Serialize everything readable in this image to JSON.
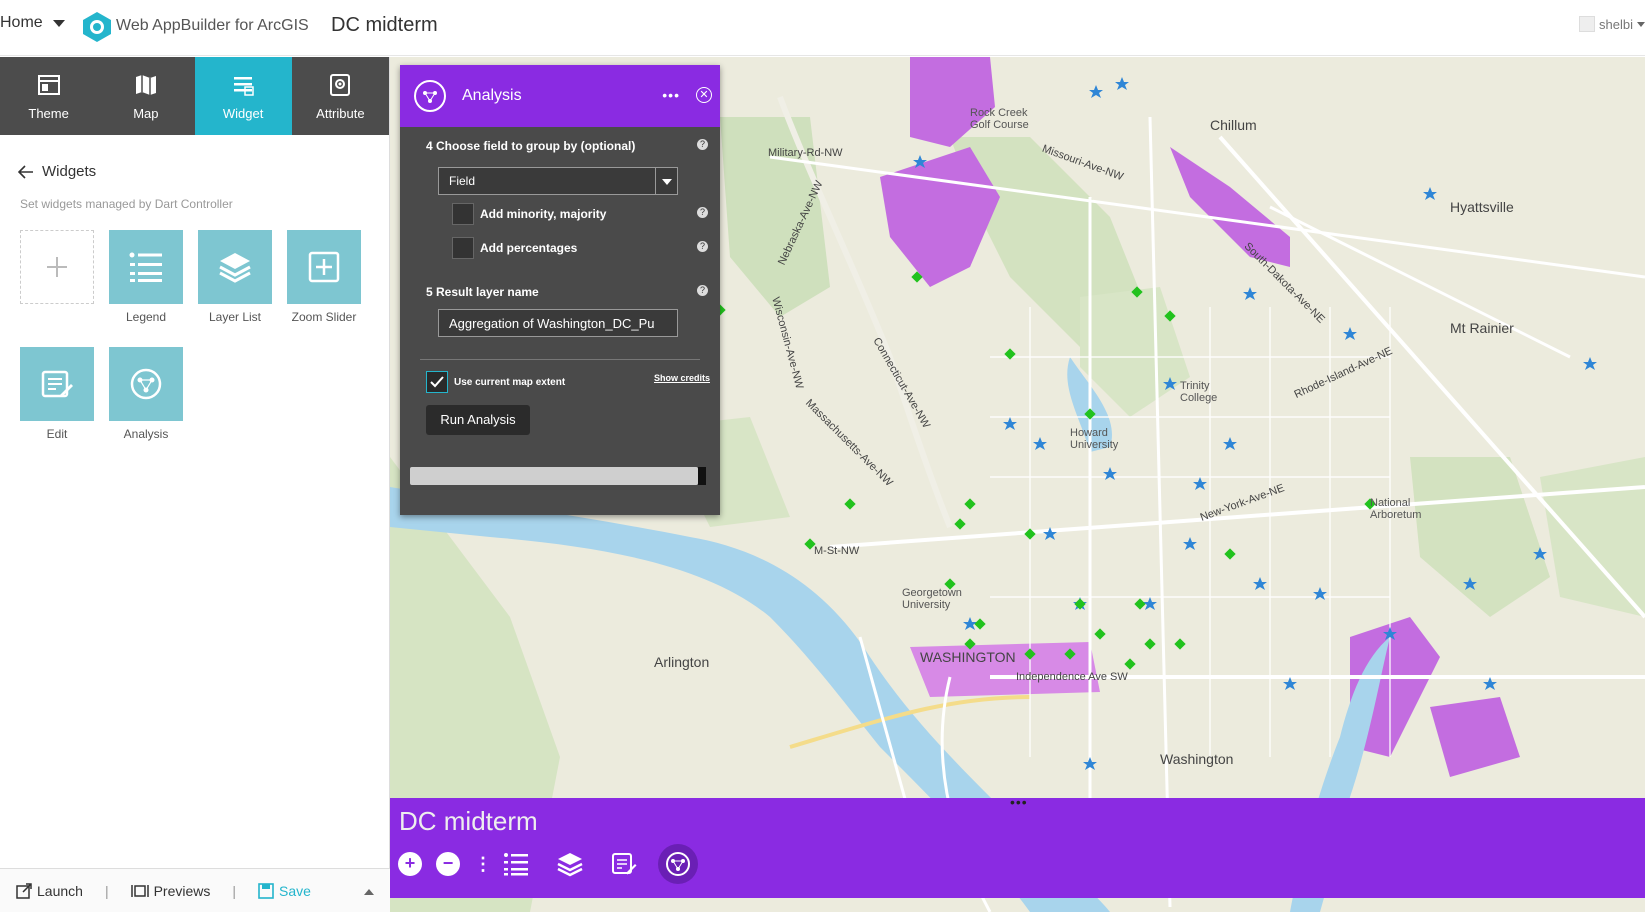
{
  "header": {
    "home_label": "Home",
    "brand_label": "Web AppBuilder for ArcGIS",
    "app_title": "DC midterm",
    "user_name": "shelbi"
  },
  "left_panel": {
    "tabs": [
      {
        "label": "Theme",
        "icon": "theme-icon"
      },
      {
        "label": "Map",
        "icon": "map-icon"
      },
      {
        "label": "Widget",
        "icon": "widget-icon"
      },
      {
        "label": "Attribute",
        "icon": "attribute-icon"
      }
    ],
    "active_tab": "Widget",
    "breadcrumb": "Widgets",
    "subtitle": "Set widgets managed by Dart Controller",
    "widgets": [
      {
        "label": "",
        "icon": "plus-icon"
      },
      {
        "label": "Legend",
        "icon": "legend-icon"
      },
      {
        "label": "Layer List",
        "icon": "layers-icon"
      },
      {
        "label": "Zoom Slider",
        "icon": "zoom-slider-icon"
      },
      {
        "label": "Edit",
        "icon": "edit-icon"
      },
      {
        "label": "Analysis",
        "icon": "analysis-icon"
      }
    ],
    "footer": {
      "launch": "Launch",
      "previews": "Previews",
      "save": "Save"
    }
  },
  "analysis_panel": {
    "title": "Analysis",
    "more": "•••",
    "close": "✕",
    "step4_label": "4 Choose field to group by (optional)",
    "field_select_value": "Field",
    "minority_label": "Add minority, majority",
    "percentages_label": "Add percentages",
    "step5_label": "5 Result layer name",
    "result_name_value": "Aggregation of Washington_DC_Pu",
    "extent_label": "Use current map extent",
    "credits_label": "Show credits",
    "run_label": "Run Analysis",
    "help_glyph": "?"
  },
  "bottom_bar": {
    "title": "DC midterm",
    "zoom_in": "+",
    "zoom_out": "−",
    "tools": [
      "legend-icon",
      "layers-icon",
      "edit-icon",
      "analysis-icon"
    ],
    "colors": {
      "bar": "#8a2be2",
      "accent": "#24b5cc"
    }
  },
  "map_labels": {
    "chillum": "Chillum",
    "hyattsville": "Hyattsville",
    "mt_rainier": "Mt Rainier",
    "washington": "WASHINGTON",
    "arlington": "Arlington",
    "military_rd": "Military-Rd-NW",
    "missouri": "Missouri-Ave-NW",
    "m_st": "M-St-NW",
    "new_york": "New-York-Ave-NE",
    "independence": "Independence Ave SW",
    "rhode_island": "Rhode-Island-Ave-NE",
    "south_dakota": "South-Dakota-Ave-NE",
    "connecticut": "Connecticut-Ave-NW",
    "massachusetts": "Massachusetts-Ave-NW",
    "wisconsin": "Wisconsin-Ave-NW",
    "georgetown": "Georgetown University",
    "howard": "Howard University",
    "national_arboretum": "National Arboretum",
    "rock_creek": "Rock Creek Golf Course",
    "trinity": "Trinity College",
    "washington_se": "Washington",
    "nebraska": "Nebraska-Ave-NW"
  }
}
